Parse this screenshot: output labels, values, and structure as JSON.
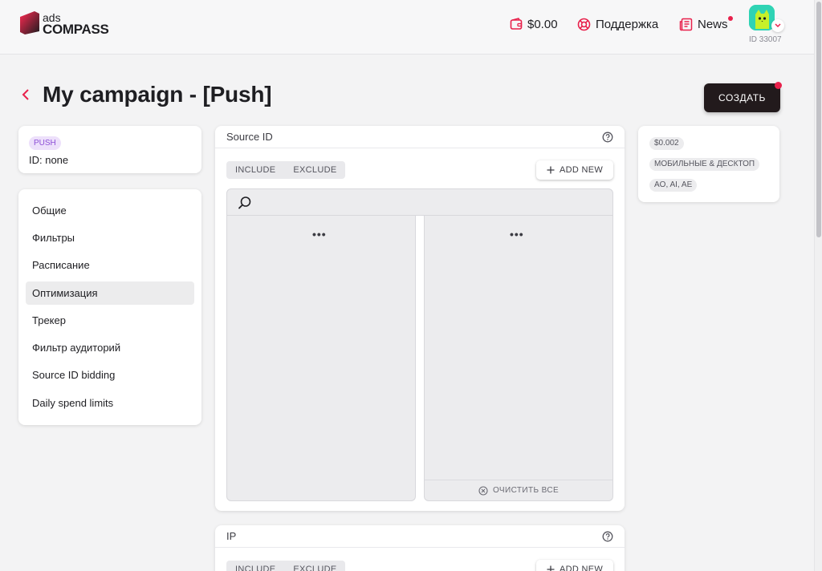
{
  "header": {
    "logo_top": "ads",
    "logo_bottom": "COMPASS",
    "balance": "$0.00",
    "support": "Поддержка",
    "news": "News",
    "user_id": "ID 33007"
  },
  "page": {
    "title": "My campaign - [Push]",
    "create_label": "СОЗДАТЬ"
  },
  "campaign_card": {
    "type_badge": "PUSH",
    "id_text": "ID: none"
  },
  "sidebar": {
    "items": [
      {
        "label": "Общие",
        "active": false
      },
      {
        "label": "Фильтры",
        "active": false
      },
      {
        "label": "Расписание",
        "active": false
      },
      {
        "label": "Оптимизация",
        "active": true
      },
      {
        "label": "Трекер",
        "active": false
      },
      {
        "label": "Фильтр аудиторий",
        "active": false
      },
      {
        "label": "Source ID bidding",
        "active": false
      },
      {
        "label": "Daily spend limits",
        "active": false
      }
    ]
  },
  "source_panel": {
    "title": "Source ID",
    "include": "INCLUDE",
    "exclude": "EXCLUDE",
    "add_new": "ADD NEW",
    "search_placeholder": "",
    "loading": "•••",
    "clear_all": "ОЧИСТИТЬ ВСЕ"
  },
  "ip_panel": {
    "title": "IP",
    "include": "INCLUDE",
    "exclude": "EXCLUDE",
    "add_new": "ADD NEW"
  },
  "summary": {
    "tags": [
      "$0.002",
      "МОБИЛЬНЫЕ & ДЕСКТОП",
      "AO, AI, AE"
    ]
  },
  "colors": {
    "accent": "#e8204b",
    "dark_button": "#221a1c",
    "badge_bg": "#ede0fb",
    "badge_text": "#8d4fd6"
  }
}
